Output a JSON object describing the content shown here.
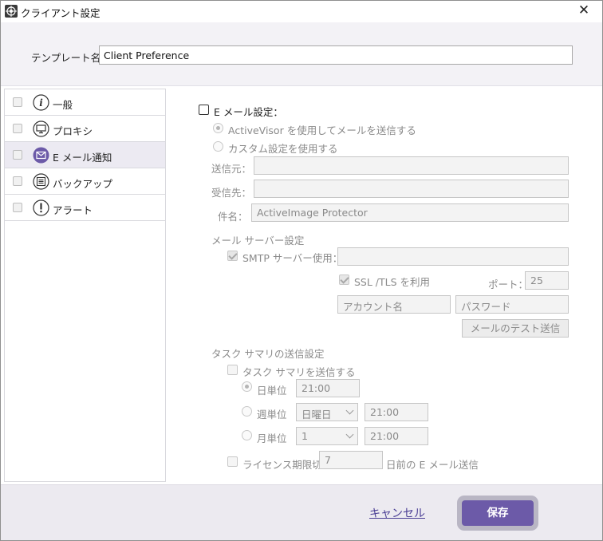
{
  "window": {
    "title": "クライアント設定",
    "close_glyph": "✕"
  },
  "template": {
    "label": "テンプレート名：",
    "value": "Client Preference"
  },
  "sidebar": {
    "items": [
      {
        "label": "一般",
        "icon": "info-icon"
      },
      {
        "label": "プロキシ",
        "icon": "monitor-icon"
      },
      {
        "label": "E メール通知",
        "icon": "mail-icon",
        "active": true
      },
      {
        "label": "バックアップ",
        "icon": "list-icon"
      },
      {
        "label": "アラート",
        "icon": "alert-icon"
      }
    ]
  },
  "email": {
    "enable_label": "E メール設定：",
    "radio_activevisor": "ActiveVisor を使用してメールを送信する",
    "radio_custom": "カスタム設定を使用する",
    "from_label": "送信元：",
    "to_label": "受信先：",
    "subject_label": "件名：",
    "subject_value": "ActiveImage Protector",
    "server_section": "メール サーバー設定",
    "smtp_label": "SMTP サーバー使用：",
    "ssl_label": "SSL /TLS を利用",
    "port_label": "ポート：",
    "port_value": "25",
    "account_placeholder": "アカウント名",
    "password_placeholder": "パスワード",
    "test_button": "メールのテスト送信",
    "summary_section": "タスク サマリの送信設定",
    "summary_check": "タスク サマリを送信する",
    "daily_label": "日単位",
    "daily_time": "21:00",
    "weekly_label": "週単位",
    "weekly_day": "日曜日",
    "weekly_time": "21:00",
    "monthly_label": "月単位",
    "monthly_day": "1",
    "monthly_time": "21:00",
    "license_label": "ライセンス期限切れ",
    "license_days": "7",
    "license_suffix": "日前の E メール送信"
  },
  "footer": {
    "cancel_label": "キャンセル",
    "save_label": "保存"
  },
  "colors": {
    "accent": "#6c5aa8",
    "link": "#4b3f95",
    "panel_bg": "#f3f2f6"
  }
}
